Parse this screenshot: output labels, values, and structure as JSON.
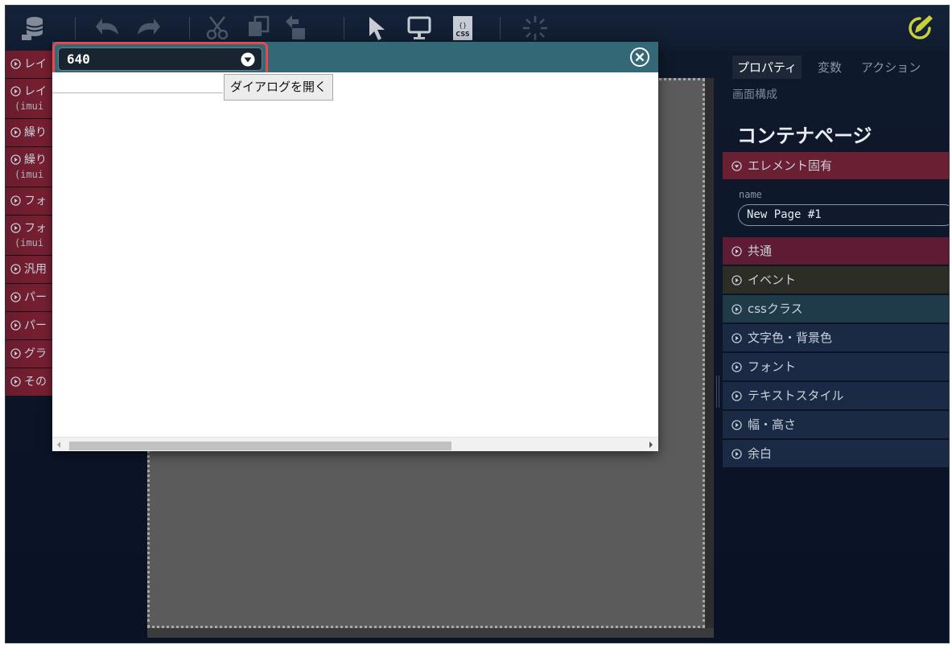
{
  "toolbar": {
    "icons": [
      "database-icon",
      "undo-icon",
      "redo-icon",
      "cut-icon",
      "copy-icon",
      "paste-icon",
      "select-pointer-icon",
      "preview-monitor-icon",
      "css-file-icon",
      "loading-icon",
      "pencil-edit-icon"
    ]
  },
  "palette": {
    "items": [
      {
        "label": "レイ",
        "sub": "",
        "color": "red"
      },
      {
        "label": "レイ",
        "sub": "(imui",
        "color": "red"
      },
      {
        "label": "繰り",
        "sub": "",
        "color": "red"
      },
      {
        "label": "繰り",
        "sub": "(imui",
        "color": "red"
      },
      {
        "label": "フォ",
        "sub": "",
        "color": "red"
      },
      {
        "label": "フォ",
        "sub": "(imui",
        "color": "red"
      },
      {
        "label": "汎用",
        "sub": "",
        "color": "red"
      },
      {
        "label": "パー",
        "sub": "",
        "color": "red"
      },
      {
        "label": "パー",
        "sub": "",
        "color": "red"
      },
      {
        "label": "グラ",
        "sub": "",
        "color": "red"
      },
      {
        "label": "その",
        "sub": "",
        "color": "red"
      }
    ]
  },
  "props": {
    "tabs": [
      "プロパティ",
      "変数",
      "アクション"
    ],
    "active_tab": "プロパティ",
    "screen_tab": "画面構成",
    "title": "コンテナページ",
    "element_section": "エレメント固有",
    "name_label": "name",
    "name_value": "New Page #1",
    "sections": [
      "共通",
      "イベント",
      "cssクラス",
      "文字色・背景色",
      "フォント",
      "テキストスタイル",
      "幅・高さ",
      "余白"
    ]
  },
  "dialog": {
    "size_value": "640",
    "open_button": "ダイアログを開く",
    "text_field_value": "",
    "scroll_fraction": 0.65
  },
  "colors": {
    "accent_red": "#e5484d",
    "dialog_header": "#336877",
    "section_red": "#6b1f33"
  }
}
